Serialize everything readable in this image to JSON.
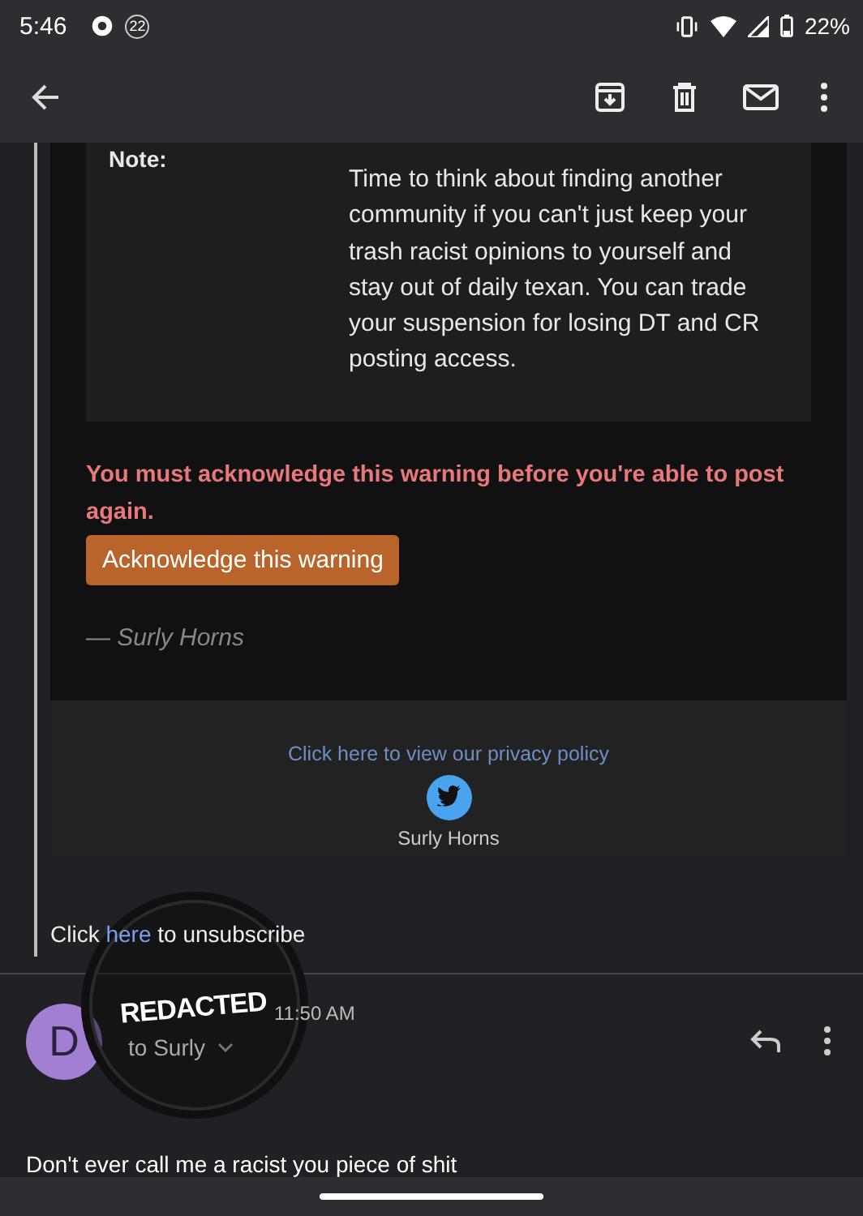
{
  "status_bar": {
    "time": "5:46",
    "notification_count": "22",
    "battery": "22%"
  },
  "note": {
    "label": "Note:",
    "text": "Time to think about finding another community if you can't just keep your trash racist opinions to yourself and stay out of daily texan. You can trade your suspension for losing DT and CR posting access."
  },
  "warning": {
    "text": "You must acknowledge this warning before you're able to post again.",
    "button": "Acknowledge this warning",
    "signature": "— Surly Horns"
  },
  "footer": {
    "privacy_link": "Click here to view our privacy policy",
    "name": "Surly Horns"
  },
  "unsubscribe": {
    "before": "Click",
    "link": "here",
    "after": "to unsubscribe"
  },
  "message": {
    "avatar_letter": "D",
    "time": "11:50 AM",
    "recipient": "to Surly",
    "body": "Don't ever call me a racist you piece of shit"
  },
  "redaction": {
    "label": "REDACTED"
  }
}
